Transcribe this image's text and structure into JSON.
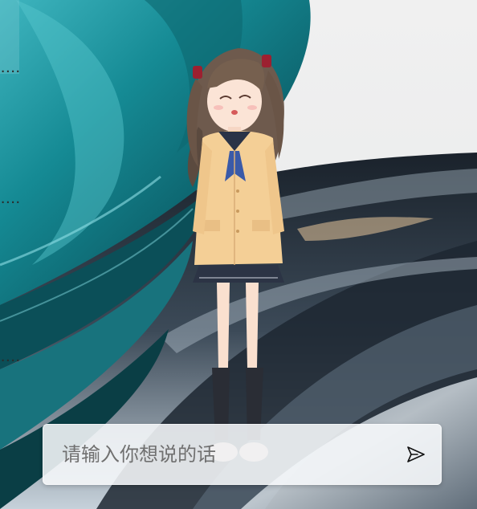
{
  "desktop": {
    "icon_labels": [
      "....",
      "....",
      "...."
    ]
  },
  "chat": {
    "placeholder": "请输入你想说的话",
    "value": ""
  },
  "icons": {
    "send": "send-icon"
  },
  "colors": {
    "wallpaper_teal": "#1f8d96",
    "wallpaper_dark": "#1b2530",
    "chat_bar_bg": "#f4f6f8",
    "placeholder_text": "#707070"
  }
}
